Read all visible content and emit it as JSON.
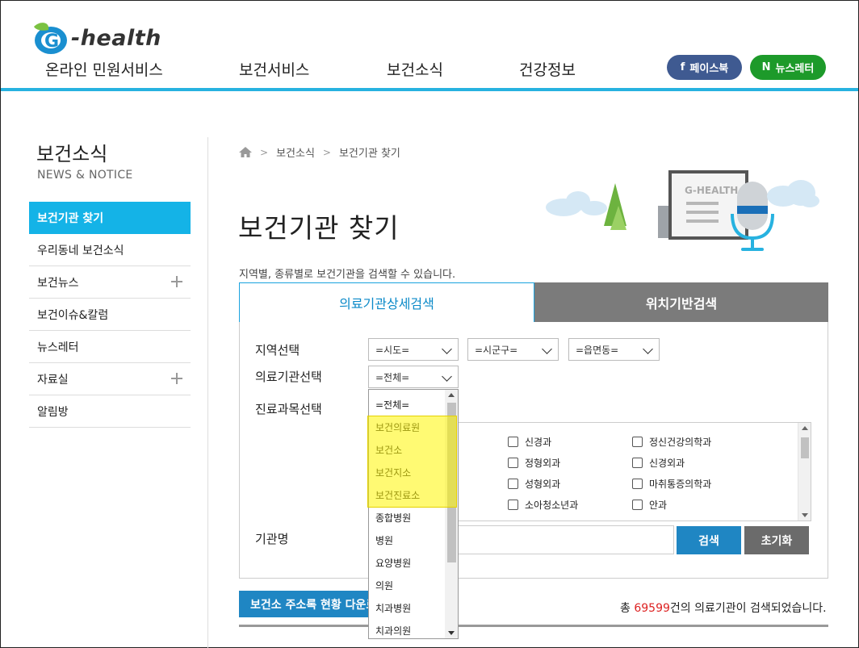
{
  "header": {
    "logo_text": "-health",
    "nav": [
      "온라인 민원서비스",
      "보건서비스",
      "보건소식",
      "건강정보"
    ],
    "facebook_label": "페이스북",
    "newsletter_label": "뉴스레터",
    "facebook_icon": "f",
    "newsletter_icon": "N"
  },
  "sidebar": {
    "title": "보건소식",
    "subtitle": "NEWS & NOTICE",
    "items": [
      {
        "label": "보건기관 찾기",
        "active": true,
        "expand": false
      },
      {
        "label": "우리동네 보건소식",
        "active": false,
        "expand": false
      },
      {
        "label": "보건뉴스",
        "active": false,
        "expand": true
      },
      {
        "label": "보건이슈&칼럼",
        "active": false,
        "expand": false
      },
      {
        "label": "뉴스레터",
        "active": false,
        "expand": false
      },
      {
        "label": "자료실",
        "active": false,
        "expand": true
      },
      {
        "label": "알림방",
        "active": false,
        "expand": false
      }
    ]
  },
  "breadcrumb": [
    "보건소식",
    "보건기관 찾기"
  ],
  "page": {
    "title": "보건기관 찾기",
    "description": "지역별, 종류별로 보건기관을 검색할 수 있습니다.",
    "illustration_label": "G-HEALTH"
  },
  "tabs": [
    "의료기관상세검색",
    "위치기반검색"
  ],
  "form": {
    "region_label": "지역선택",
    "region_selects": [
      "=시도=",
      "=시군구=",
      "=읍면동="
    ],
    "type_label": "의료기관선택",
    "type_value": "=전체=",
    "dept_label": "진료과목선택",
    "name_label": "기관명",
    "search_button": "검색",
    "reset_button": "초기화",
    "departments": [
      [
        "신경과",
        "정신건강의학과"
      ],
      [
        "정형외과",
        "신경외과"
      ],
      [
        "성형외과",
        "마취통증의학과"
      ],
      [
        "소아청소년과",
        "안과"
      ]
    ]
  },
  "dropdown_options": [
    "=전체=",
    "보건의료원",
    "보건소",
    "보건지소",
    "보건진료소",
    "종합병원",
    "병원",
    "요양병원",
    "의원",
    "치과병원",
    "치과의원"
  ],
  "bottom": {
    "address_button": "보건소 주소록 현황 다운로드",
    "result_prefix": "총 ",
    "result_count": "69599",
    "result_suffix": "건의 의료기관이 검색되었습니다."
  },
  "colors": {
    "accent": "#14b3e7",
    "primary_button": "#1f86c3",
    "highlight": "#fff600"
  }
}
